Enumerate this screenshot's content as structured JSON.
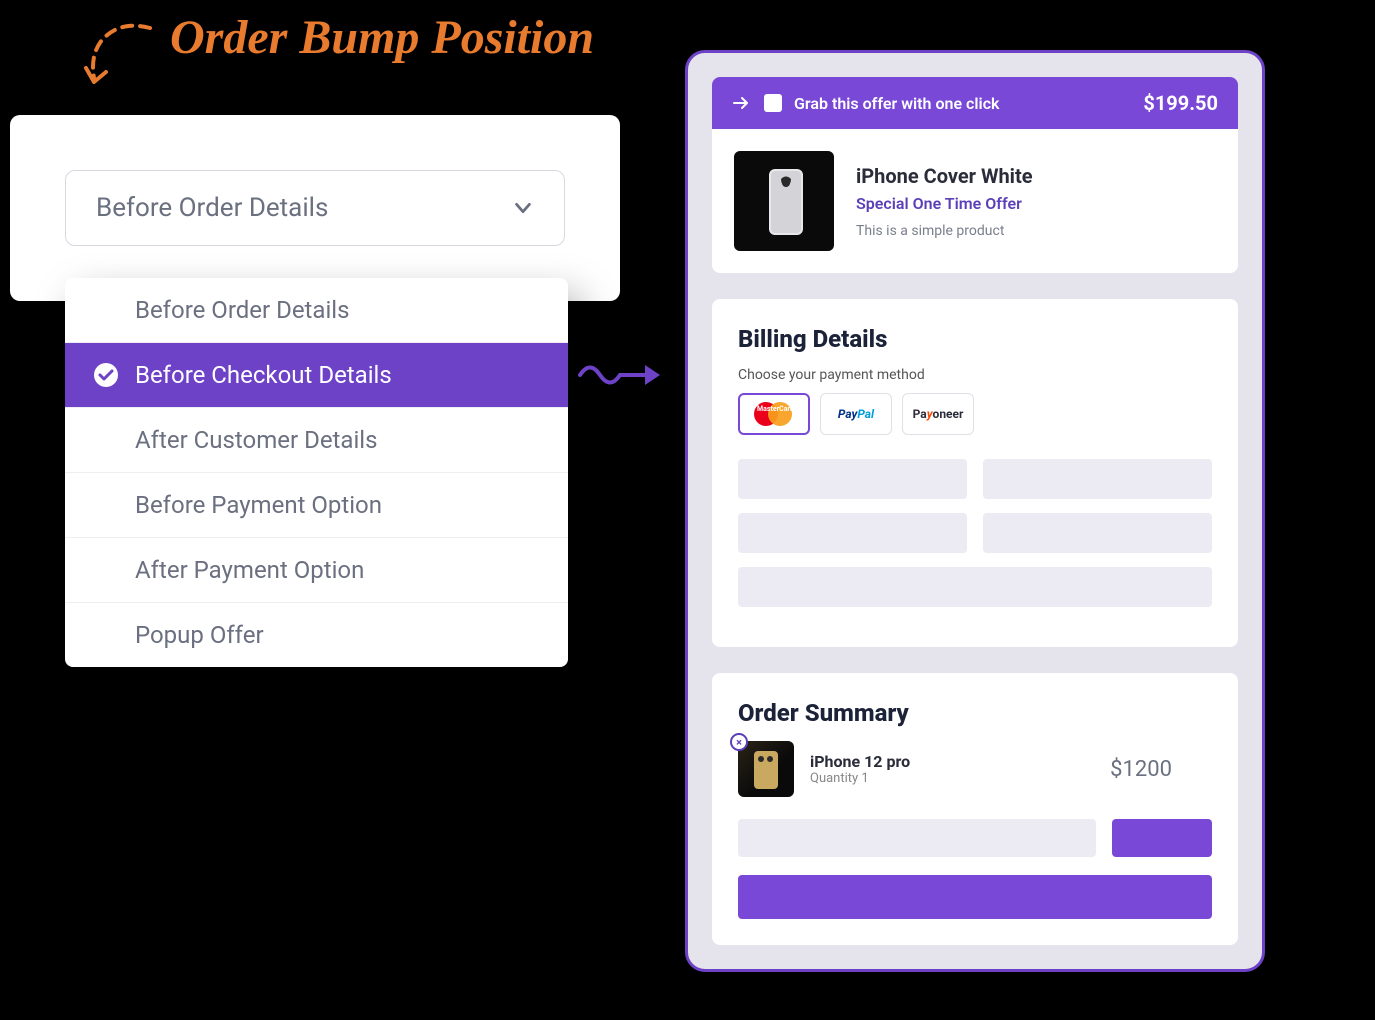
{
  "annotation": {
    "title": "Order Bump Position"
  },
  "select": {
    "value": "Before Order Details"
  },
  "options": [
    {
      "label": "Before Order Details",
      "selected": false
    },
    {
      "label": "Before Checkout Details",
      "selected": true
    },
    {
      "label": "After Customer Details",
      "selected": false
    },
    {
      "label": "Before Payment Option",
      "selected": false
    },
    {
      "label": "After Payment Option",
      "selected": false
    },
    {
      "label": "Popup Offer",
      "selected": false
    }
  ],
  "offer": {
    "cta": "Grab this offer with one click",
    "price": "$199.50",
    "product_title": "iPhone Cover White",
    "product_subtitle": "Special One Time Offer",
    "product_desc": "This is a simple product"
  },
  "billing": {
    "title": "Billing Details",
    "subtitle": "Choose your payment method",
    "methods": [
      "MasterCard",
      "PayPal",
      "Payoneer"
    ]
  },
  "summary": {
    "title": "Order Summary",
    "item": {
      "name": "iPhone 12 pro",
      "qty": "Quantity 1",
      "price": "$1200"
    }
  }
}
